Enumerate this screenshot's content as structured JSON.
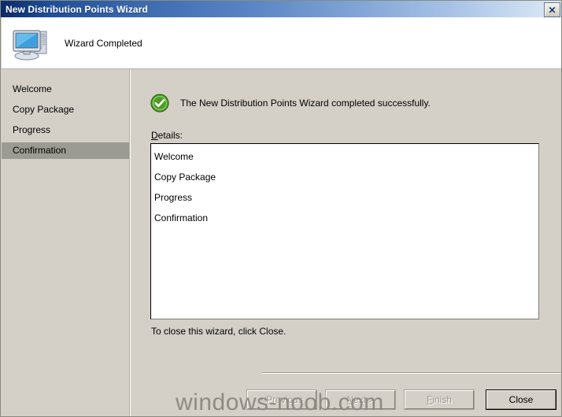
{
  "window": {
    "title": "New Distribution Points Wizard",
    "close_icon": "close-icon",
    "close_glyph": "✕"
  },
  "header": {
    "icon": "computer-icon",
    "title": "Wizard Completed"
  },
  "sidebar": {
    "items": [
      {
        "label": "Welcome",
        "selected": false
      },
      {
        "label": "Copy Package",
        "selected": false
      },
      {
        "label": "Progress",
        "selected": false
      },
      {
        "label": "Confirmation",
        "selected": true
      }
    ]
  },
  "content": {
    "status_icon": "success-check-icon",
    "status_text": "The New Distribution Points Wizard completed successfully.",
    "details_label_accel": "D",
    "details_label_rest": "etails:",
    "details_items": [
      "Welcome",
      "Copy Package",
      "Progress",
      "Confirmation"
    ],
    "closing_hint": "To close this wizard, click Close."
  },
  "buttons": [
    {
      "name": "previous-button",
      "prefix": "< ",
      "accel": "P",
      "suffix": "revious",
      "disabled": true,
      "default": false
    },
    {
      "name": "next-button",
      "prefix": "",
      "accel": "N",
      "suffix": "ext >",
      "disabled": true,
      "default": false
    },
    {
      "name": "finish-button",
      "prefix": "",
      "accel": "F",
      "suffix": "inish",
      "disabled": true,
      "default": false
    },
    {
      "name": "close-button",
      "prefix": "",
      "accel": "",
      "suffix": "Close",
      "disabled": false,
      "default": true
    }
  ],
  "watermark": {
    "text": "windows-noob.com"
  },
  "colors": {
    "dialog_face": "#d4d0c8",
    "title_start": "#0a2a66",
    "title_end": "#dfeaf7",
    "selection": "#9b9b93",
    "success_green": "#4e9b28",
    "watermark": "#8e8b84"
  }
}
